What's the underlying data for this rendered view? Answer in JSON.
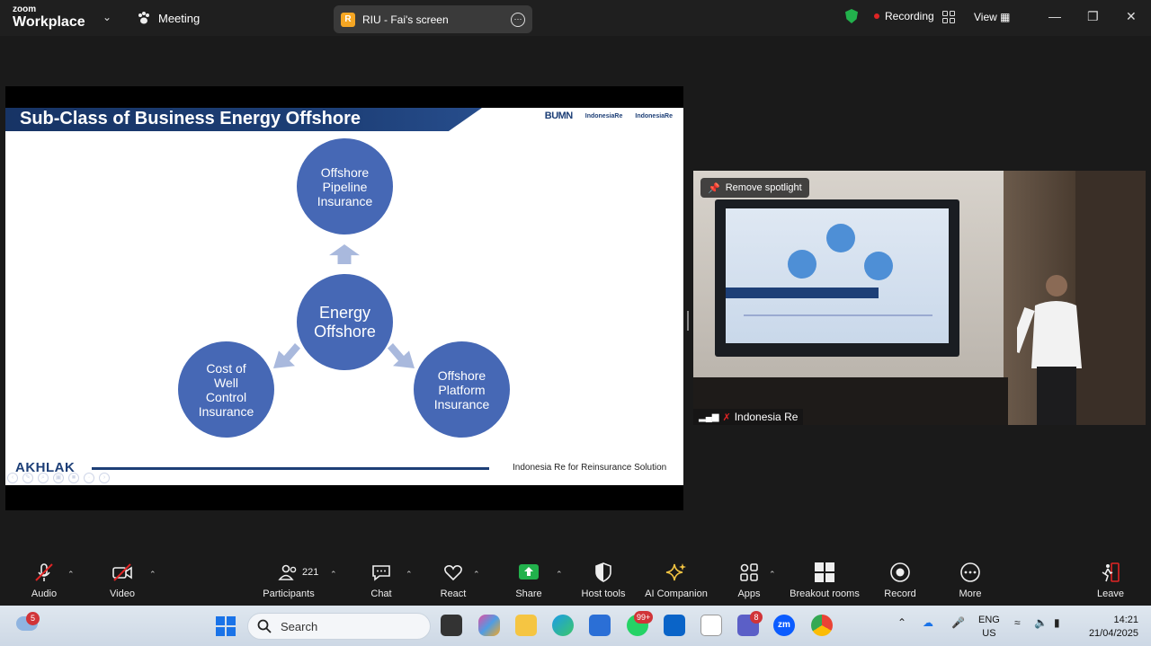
{
  "app": {
    "brand_top": "zoom",
    "brand_bottom": "Workplace",
    "meeting_label": "Meeting"
  },
  "screen_share": {
    "icon_letter": "R",
    "label": "RIU - Fai's screen"
  },
  "status": {
    "recording": "Recording",
    "view": "View"
  },
  "slide": {
    "title": "Sub-Class of Business Energy Offshore",
    "logos": [
      "BUMN",
      "IndonesiaRe",
      "IndonesiaRe"
    ],
    "center": "Energy\nOffshore",
    "top": "Offshore\nPipeline\nInsurance",
    "left": "Cost of\nWell\nControl\nInsurance",
    "right": "Offshore\nPlatform\nInsurance",
    "footer_brand": "AKHLAK",
    "footer_text": "Indonesia Re for Reinsurance Solution"
  },
  "video": {
    "remove_spotlight": "Remove spotlight",
    "participant_name": "Indonesia Re"
  },
  "toolbar": {
    "audio": "Audio",
    "video": "Video",
    "participants": "Participants",
    "participants_count": "221",
    "chat": "Chat",
    "react": "React",
    "share": "Share",
    "host_tools": "Host tools",
    "ai_companion": "AI Companion",
    "apps": "Apps",
    "breakout_rooms": "Breakout rooms",
    "record": "Record",
    "more": "More",
    "leave": "Leave"
  },
  "taskbar": {
    "weather_badge": "5",
    "search_placeholder": "Search",
    "whatsapp_badge": "99+",
    "teams_badge": "8",
    "zoom_label": "zm",
    "lang_top": "ENG",
    "lang_bottom": "US",
    "time": "14:21",
    "date": "21/04/2025"
  },
  "colors": {
    "accent_blue": "#4668b5",
    "slide_navy": "#1d3f77",
    "recording_red": "#e02424",
    "secure_green": "#22b14c"
  }
}
